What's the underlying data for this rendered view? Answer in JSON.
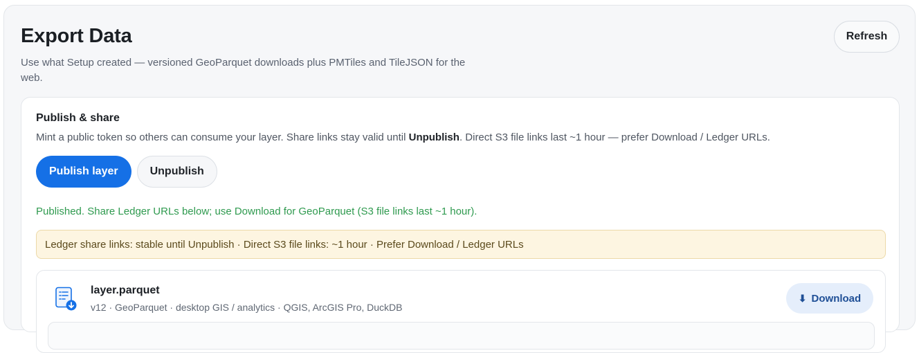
{
  "header": {
    "title": "Export Data",
    "subtitle": "Use what Setup created — versioned GeoParquet downloads plus PMTiles and TileJSON for the web.",
    "refresh_label": "Refresh"
  },
  "publish": {
    "title": "Publish & share",
    "desc_before": "Mint a public token so others can consume your layer. Share links stay valid until ",
    "desc_bold": "Unpublish",
    "desc_after": ". Direct S3 file links last ~1 hour — prefer Download / Ledger URLs.",
    "publish_label": "Publish layer",
    "unpublish_label": "Unpublish",
    "status": "Published. Share Ledger URLs below; use Download for GeoParquet (S3 file links last ~1 hour).",
    "notice": "Ledger share links: stable until Unpublish · Direct S3 file links: ~1 hour · Prefer Download / Ledger URLs"
  },
  "file": {
    "name": "layer.parquet",
    "meta": "v12 · GeoParquet · desktop GIS / analytics · QGIS, ArcGIS Pro, DuckDB",
    "download_label": "Download",
    "icon": "file-download-icon",
    "download_icon": "download-arrow-icon"
  },
  "colors": {
    "primary": "#1570e6",
    "success": "#2f9a4f",
    "notice_bg": "#fdf5e1",
    "download_bg": "#e5eefb"
  }
}
